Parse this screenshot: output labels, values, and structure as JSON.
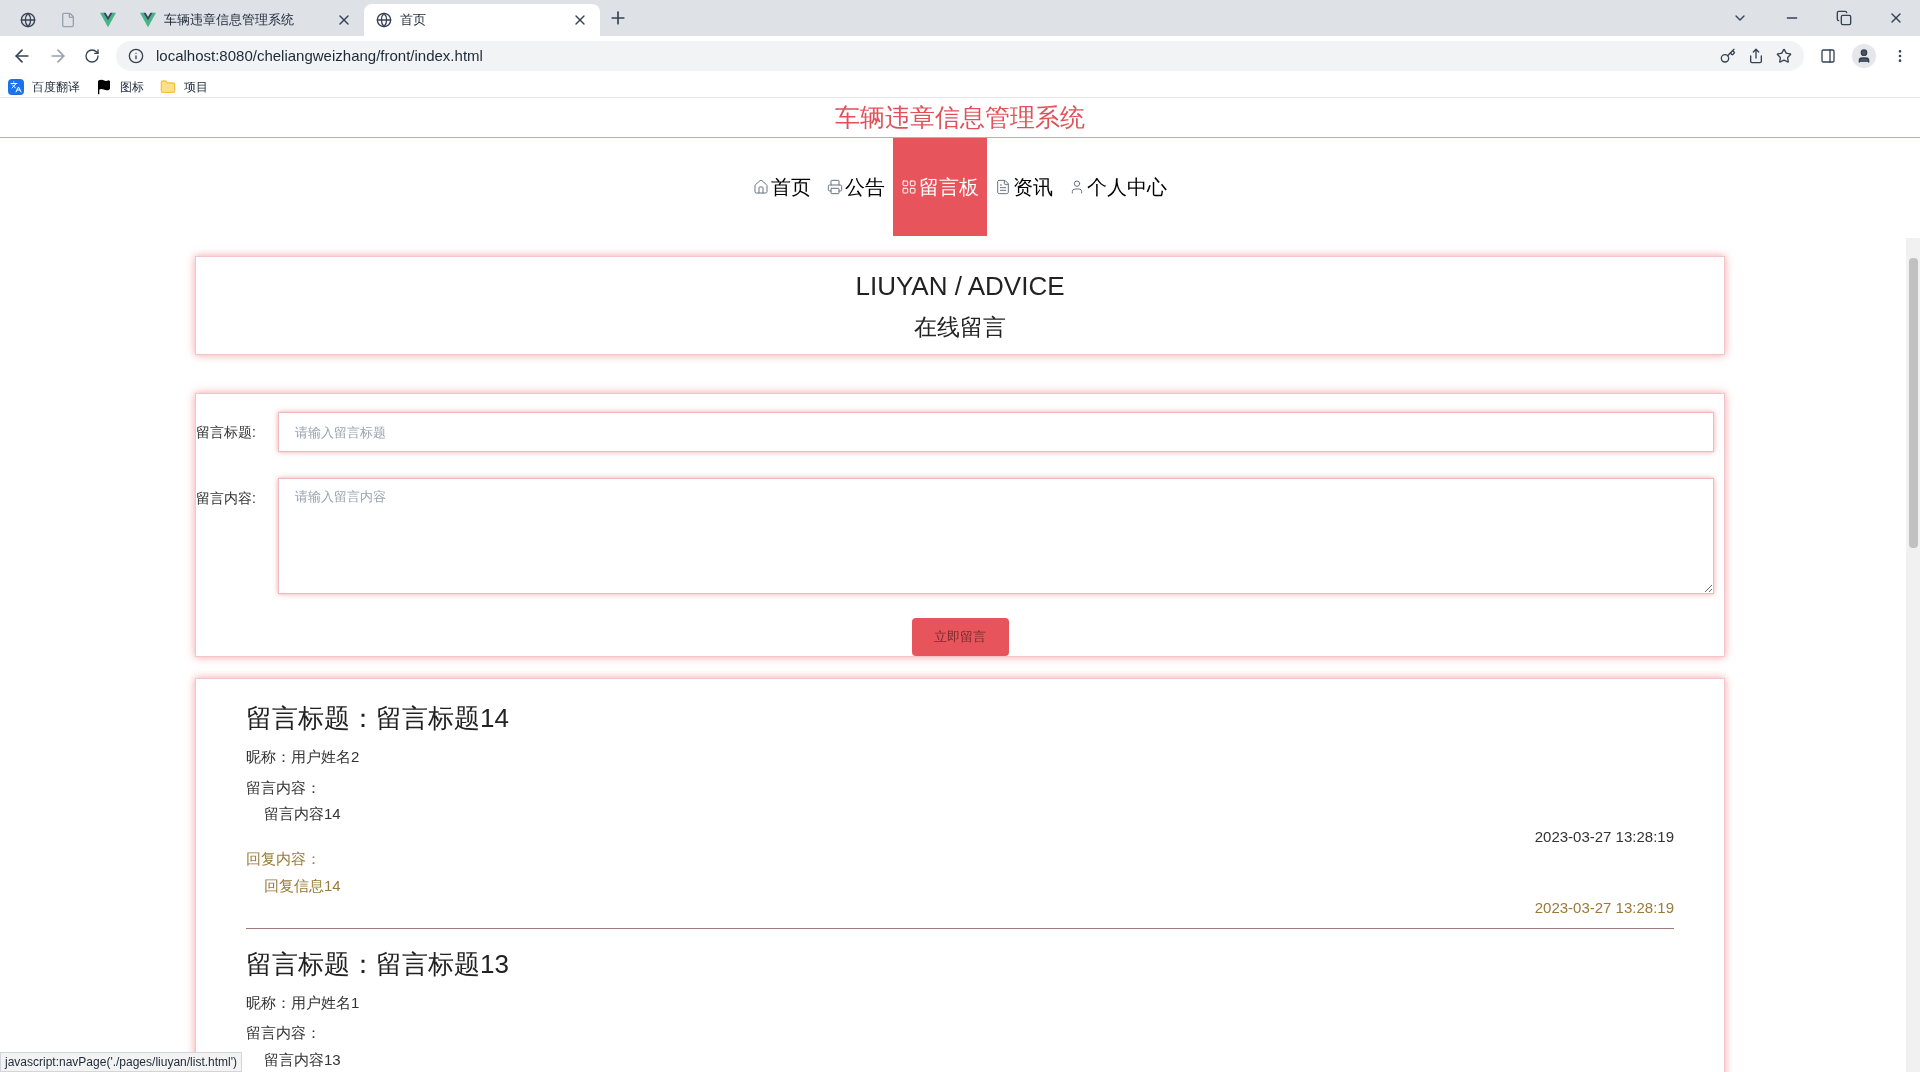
{
  "browser": {
    "tabs": [
      {
        "kind": "globe",
        "selected": false
      },
      {
        "kind": "page",
        "selected": false
      },
      {
        "kind": "vue",
        "selected": false
      },
      {
        "kind": "vue",
        "label": "车辆违章信息管理系统",
        "selected": false
      },
      {
        "kind": "globe",
        "label": "首页",
        "selected": true
      }
    ],
    "address": "localhost:8080/cheliangweizhang/front/index.html",
    "bookmarks": [
      {
        "kind": "translate",
        "label": "百度翻译"
      },
      {
        "kind": "flag",
        "label": "图标"
      },
      {
        "kind": "folder",
        "label": "项目"
      }
    ]
  },
  "site_title": "车辆违章信息管理系统",
  "nav": [
    {
      "kind": "home",
      "label": "首页",
      "selected": false
    },
    {
      "kind": "print",
      "label": "公告",
      "selected": false
    },
    {
      "kind": "board",
      "label": "留言板",
      "selected": true
    },
    {
      "kind": "doc",
      "label": "资讯",
      "selected": false
    },
    {
      "kind": "user",
      "label": "个人中心",
      "selected": false
    }
  ],
  "banner": {
    "title": "LIUYAN / ADVICE",
    "subtitle": "在线留言"
  },
  "form": {
    "fields": [
      {
        "kind": "input",
        "label": "留言标题:",
        "placeholder": "请输入留言标题"
      },
      {
        "kind": "textarea",
        "label": "留言内容:",
        "placeholder": "请输入留言内容"
      }
    ],
    "submit": "立即留言"
  },
  "messages": [
    {
      "title": "留言标题：留言标题14",
      "nickname": "昵称：用户姓名2",
      "content_label": "留言内容：",
      "content": "留言内容14",
      "time": "2023-03-27 13:28:19",
      "reply_label": "回复内容：",
      "reply": "回复信息14",
      "reply_time": "2023-03-27 13:28:19"
    },
    {
      "title": "留言标题：留言标题13",
      "nickname": "昵称：用户姓名1",
      "content_label": "留言内容：",
      "content": "留言内容13"
    }
  ],
  "status_bar": "javascript:navPage('./pages/liuyan/list.html')"
}
